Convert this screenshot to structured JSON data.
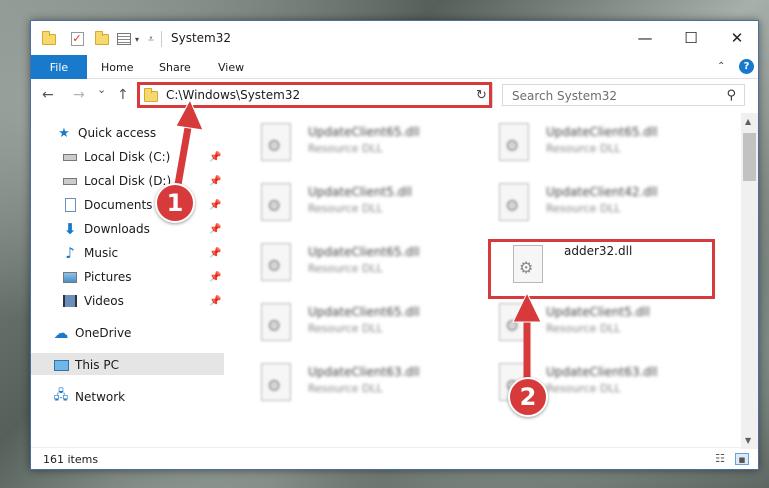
{
  "window": {
    "title": "System32",
    "minimize": "—",
    "maximize": "☐",
    "close": "✕"
  },
  "ribbon": {
    "tabs": [
      "File",
      "Home",
      "Share",
      "View"
    ],
    "collapse_icon": "chevron-up-icon",
    "help": "?"
  },
  "address": {
    "path": "C:\\Windows\\System32",
    "back": "←",
    "forward": "→",
    "history": "⌄",
    "up": "↑",
    "refresh": "↻",
    "dropdown": "⌄"
  },
  "search": {
    "placeholder": "Search System32",
    "icon": "⚲"
  },
  "nav": {
    "quick_access": "Quick access",
    "items": [
      {
        "label": "Local Disk (C:)",
        "icon": "drive-icon"
      },
      {
        "label": "Local Disk (D:)",
        "icon": "drive-icon"
      },
      {
        "label": "Documents",
        "icon": "document-icon"
      },
      {
        "label": "Downloads",
        "icon": "download-icon"
      },
      {
        "label": "Music",
        "icon": "music-icon"
      },
      {
        "label": "Pictures",
        "icon": "picture-icon"
      },
      {
        "label": "Videos",
        "icon": "video-icon"
      }
    ],
    "onedrive": "OneDrive",
    "this_pc": "This PC",
    "network": "Network"
  },
  "files": [
    {
      "name": "UpdateClient65.dll",
      "desc": "Resource DLL"
    },
    {
      "name": "UpdateClient65.dll",
      "desc": "Resource DLL"
    },
    {
      "name": "UpdateClient5.dll",
      "desc": "Resource DLL"
    },
    {
      "name": "UpdateClient42.dll",
      "desc": "Resource DLL"
    },
    {
      "name": "UpdateClient65.dll",
      "desc": "Resource DLL"
    },
    {
      "name": "adder32.dll",
      "desc": ""
    },
    {
      "name": "UpdateClient65.dll",
      "desc": "Resource DLL"
    },
    {
      "name": "UpdateClient5.dll",
      "desc": "Resource DLL"
    },
    {
      "name": "UpdateClient63.dll",
      "desc": "Resource DLL"
    },
    {
      "name": "UpdateClient63.dll",
      "desc": "Resource DLL"
    }
  ],
  "status": {
    "count": "161 items"
  },
  "callouts": {
    "one": "1",
    "two": "2"
  },
  "colors": {
    "accent": "#1979ca",
    "highlight": "#d63a3a"
  }
}
